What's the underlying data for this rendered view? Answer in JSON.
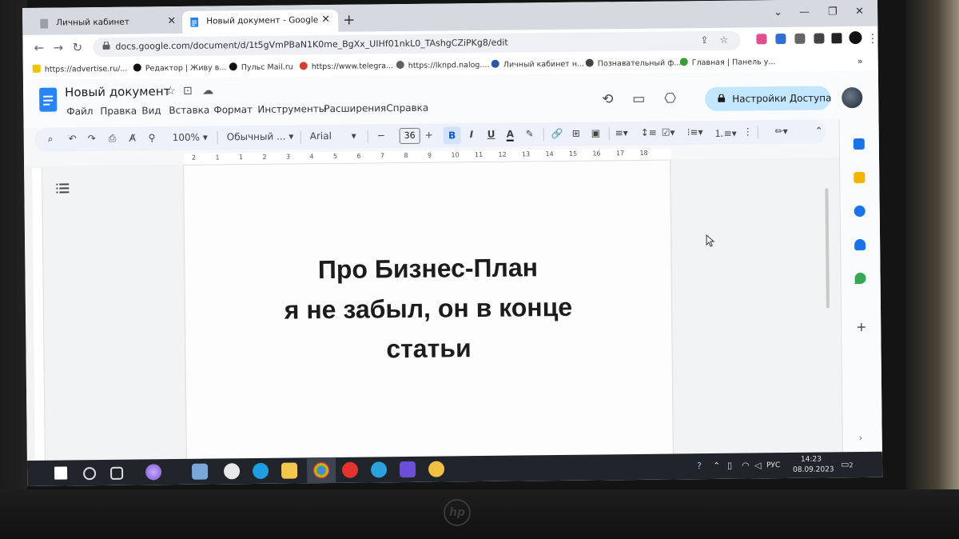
{
  "browser": {
    "tabs": [
      {
        "title": "Личный кабинет",
        "active": false
      },
      {
        "title": "Новый документ - Google Доку",
        "active": true
      }
    ],
    "new_tab": "+",
    "url": "docs.google.com/document/d/1t5gVmPBaN1K0me_BgXx_UIHf01nkL0_TAshgCZiPKg8/edit",
    "bookmarks": [
      {
        "label": "https://advertise.ru/...",
        "icon": "A-icon",
        "color": "#f2c400"
      },
      {
        "label": "Редактор | Живу в...",
        "icon": "zen-icon",
        "color": "#111111"
      },
      {
        "label": "Пульс Mail.ru",
        "icon": "mail-pulse-icon",
        "color": "#111111"
      },
      {
        "label": "https://www.telegra...",
        "icon": "telegraph-icon",
        "color": "#d83a2f"
      },
      {
        "label": "https://lknpd.nalog....",
        "icon": "globe-icon",
        "color": "#5f6368"
      },
      {
        "label": "Личный кабинет н...",
        "icon": "nalog-icon",
        "color": "#2b57a8"
      },
      {
        "label": "Познавательный ф...",
        "icon": "globe-icon",
        "color": "#444444"
      },
      {
        "label": "Главная | Панель у...",
        "icon": "green-3-icon",
        "color": "#3a9b3a"
      }
    ],
    "bookmarks_more": "»"
  },
  "docs": {
    "title": "Новый документ",
    "menu": [
      "Файл",
      "Правка",
      "Вид",
      "Вставка",
      "Формат",
      "Инструменты",
      "Расширения",
      "Справка"
    ],
    "share_label": "Настройки Доступа",
    "toolbar": {
      "zoom": "100%",
      "style": "Обычный ...",
      "font": "Arial",
      "font_size": "36",
      "bold": "B",
      "italic": "I",
      "underline": "U",
      "text_color": "A"
    },
    "ruler_numbers": [
      "2",
      "1",
      "1",
      "2",
      "3",
      "4",
      "5",
      "6",
      "7",
      "8",
      "9",
      "10",
      "11",
      "12",
      "13",
      "14",
      "15",
      "16",
      "17",
      "18"
    ],
    "body_lines": [
      "Про Бизнес-План",
      "я не забыл, он в конце",
      "статьи"
    ]
  },
  "taskbar": {
    "lang": "РУС",
    "time": "14:23",
    "date": "08.09.2023",
    "notifications": "2"
  }
}
